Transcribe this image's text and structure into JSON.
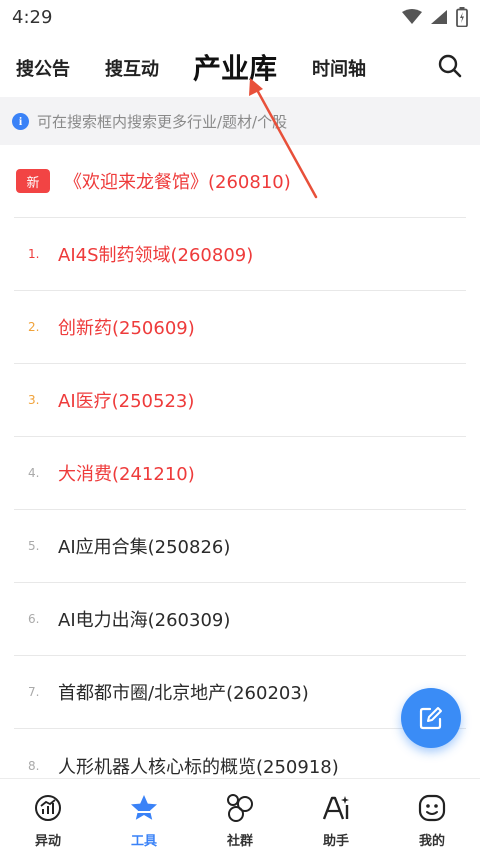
{
  "status": {
    "time": "4:29",
    "icons": [
      "wifi-icon",
      "signal-icon",
      "battery-icon"
    ]
  },
  "top_tabs": [
    {
      "label": "搜公告"
    },
    {
      "label": "搜互动"
    },
    {
      "label": "产业库",
      "active": true
    },
    {
      "label": "时间轴"
    }
  ],
  "hint": {
    "text": "可在搜索框内搜索更多行业/题材/个股"
  },
  "list": {
    "new_badge": "新",
    "items": [
      {
        "rank": "",
        "text": "《欢迎来龙餐馆》(260810)"
      },
      {
        "rank": "1.",
        "text": "AI4S制药领域(260809)"
      },
      {
        "rank": "2.",
        "text": "创新药(250609)"
      },
      {
        "rank": "3.",
        "text": "AI医疗(250523)"
      },
      {
        "rank": "4.",
        "text": "大消费(241210)"
      },
      {
        "rank": "5.",
        "text": "AI应用合集(250826)"
      },
      {
        "rank": "6.",
        "text": "AI电力出海(260309)"
      },
      {
        "rank": "7.",
        "text": "首都都市圈/北京地产(260203)"
      },
      {
        "rank": "8.",
        "text": "人形机器人核心标的概览(250918)"
      }
    ]
  },
  "bottom_nav": [
    {
      "label": "异动",
      "icon": "chart-icon"
    },
    {
      "label": "工具",
      "icon": "star-icon",
      "active": true
    },
    {
      "label": "社群",
      "icon": "circles-icon"
    },
    {
      "label": "助手",
      "icon": "ai-icon"
    },
    {
      "label": "我的",
      "icon": "smile-icon"
    }
  ],
  "colors": {
    "accent": "#3a82f7",
    "hot": "#ee3b3b",
    "rank_orange": "#f0a23a",
    "annotation": "#e8503a"
  }
}
